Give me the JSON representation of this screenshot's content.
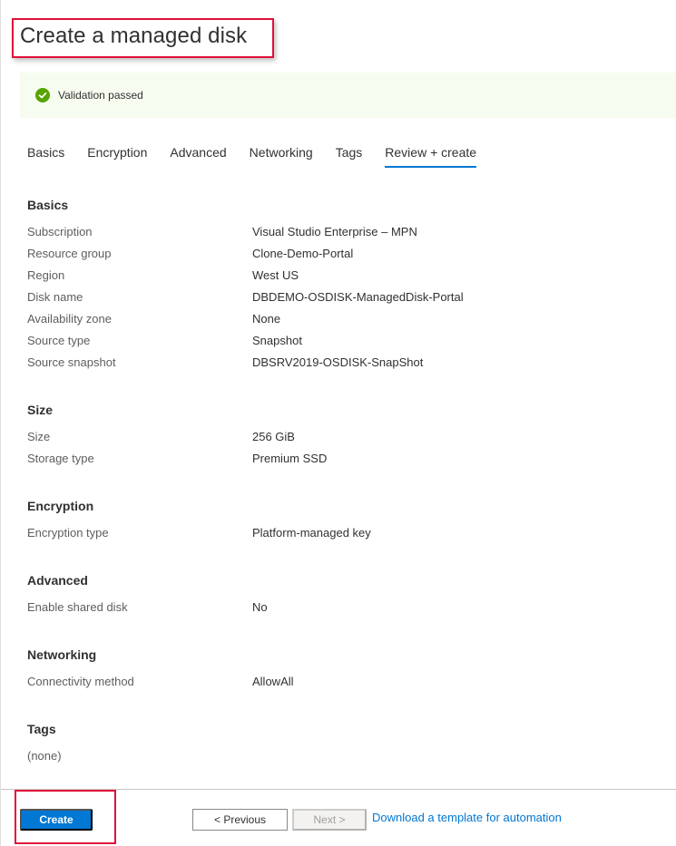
{
  "header": {
    "title": "Create a managed disk"
  },
  "banner": {
    "icon": "check-circle-icon",
    "text": "Validation passed",
    "color": "#57a300"
  },
  "tabs": [
    {
      "label": "Basics",
      "active": false
    },
    {
      "label": "Encryption",
      "active": false
    },
    {
      "label": "Advanced",
      "active": false
    },
    {
      "label": "Networking",
      "active": false
    },
    {
      "label": "Tags",
      "active": false
    },
    {
      "label": "Review + create",
      "active": true
    }
  ],
  "sections": {
    "basics": {
      "title": "Basics",
      "rows": [
        {
          "label": "Subscription",
          "value": "Visual Studio Enterprise – MPN"
        },
        {
          "label": "Resource group",
          "value": "Clone-Demo-Portal"
        },
        {
          "label": "Region",
          "value": "West US"
        },
        {
          "label": "Disk name",
          "value": "DBDEMO-OSDISK-ManagedDisk-Portal"
        },
        {
          "label": "Availability zone",
          "value": "None"
        },
        {
          "label": "Source type",
          "value": "Snapshot"
        },
        {
          "label": "Source snapshot",
          "value": "DBSRV2019-OSDISK-SnapShot"
        }
      ]
    },
    "size": {
      "title": "Size",
      "rows": [
        {
          "label": "Size",
          "value": "256 GiB"
        },
        {
          "label": "Storage type",
          "value": "Premium SSD"
        }
      ]
    },
    "encryption": {
      "title": "Encryption",
      "rows": [
        {
          "label": "Encryption type",
          "value": "Platform-managed key"
        }
      ]
    },
    "advanced": {
      "title": "Advanced",
      "rows": [
        {
          "label": "Enable shared disk",
          "value": "No"
        }
      ]
    },
    "networking": {
      "title": "Networking",
      "rows": [
        {
          "label": "Connectivity method",
          "value": "AllowAll"
        }
      ]
    },
    "tags": {
      "title": "Tags",
      "rows": [
        {
          "label": "(none)",
          "value": ""
        }
      ]
    }
  },
  "footer": {
    "create_label": "Create",
    "previous_label": "< Previous",
    "next_label": "Next >",
    "next_disabled": true,
    "download_link": "Download a template for automation"
  },
  "colors": {
    "accent": "#0078d4",
    "highlight_box": "#e0103a",
    "success": "#57a300"
  }
}
